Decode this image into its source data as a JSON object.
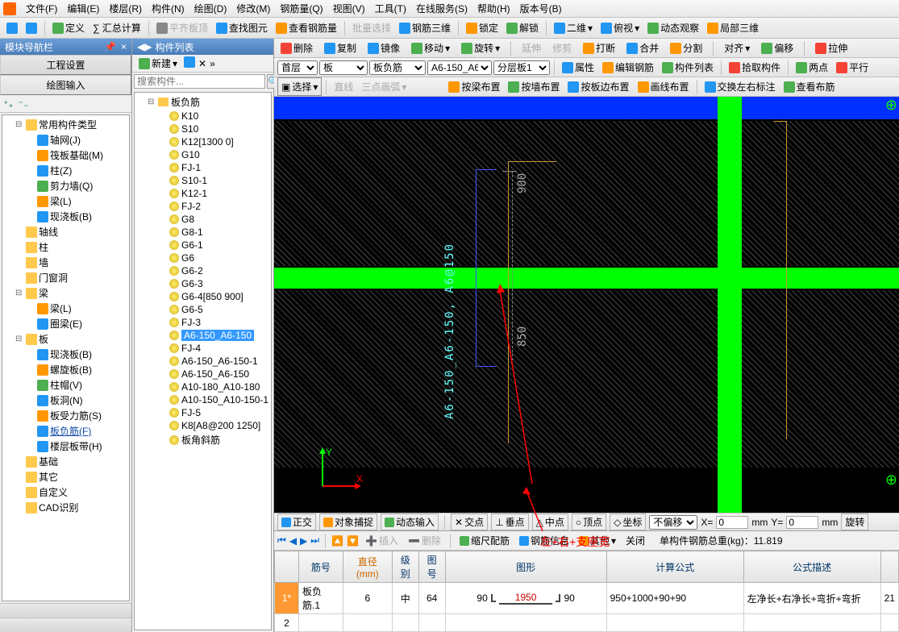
{
  "menubar": {
    "items": [
      "文件(F)",
      "编辑(E)",
      "楼层(R)",
      "构件(N)",
      "绘图(D)",
      "修改(M)",
      "钢筋量(Q)",
      "视图(V)",
      "工具(T)",
      "在线服务(S)",
      "帮助(H)",
      "版本号(B)"
    ]
  },
  "toolbar1": {
    "items": [
      "定义",
      "∑ 汇总计算",
      "平齐板顶",
      "查找图元",
      "查看钢筋量",
      "批量选择",
      "钢筋三维",
      "锁定",
      "解锁",
      "二维",
      "俯视",
      "动态观察",
      "局部三维"
    ]
  },
  "navpanel": {
    "title": "模块导航栏",
    "tabs": [
      "工程设置",
      "绘图输入"
    ],
    "tree": [
      {
        "label": "常用构件类型",
        "icon": "folder",
        "exp": true,
        "children": [
          {
            "label": "轴网(J)",
            "icon": "blue"
          },
          {
            "label": "筏板基础(M)",
            "icon": "orange"
          },
          {
            "label": "柱(Z)",
            "icon": "blue"
          },
          {
            "label": "剪力墙(Q)",
            "icon": "green"
          },
          {
            "label": "梁(L)",
            "icon": "orange"
          },
          {
            "label": "现浇板(B)",
            "icon": "blue"
          }
        ]
      },
      {
        "label": "轴线",
        "icon": "folder"
      },
      {
        "label": "柱",
        "icon": "folder"
      },
      {
        "label": "墙",
        "icon": "folder"
      },
      {
        "label": "门窗洞",
        "icon": "folder"
      },
      {
        "label": "梁",
        "icon": "folder",
        "exp": true,
        "children": [
          {
            "label": "梁(L)",
            "icon": "orange"
          },
          {
            "label": "圈梁(E)",
            "icon": "blue"
          }
        ]
      },
      {
        "label": "板",
        "icon": "folder",
        "exp": true,
        "children": [
          {
            "label": "现浇板(B)",
            "icon": "blue"
          },
          {
            "label": "螺旋板(B)",
            "icon": "orange"
          },
          {
            "label": "柱帽(V)",
            "icon": "green"
          },
          {
            "label": "板洞(N)",
            "icon": "blue"
          },
          {
            "label": "板受力筋(S)",
            "icon": "orange"
          },
          {
            "label": "板负筋(F)",
            "icon": "blue",
            "sel": true
          },
          {
            "label": "楼层板带(H)",
            "icon": "blue"
          }
        ]
      },
      {
        "label": "基础",
        "icon": "folder"
      },
      {
        "label": "其它",
        "icon": "folder"
      },
      {
        "label": "自定义",
        "icon": "folder"
      },
      {
        "label": "CAD识别",
        "icon": "folder"
      }
    ]
  },
  "complist": {
    "title": "构件列表",
    "newBtn": "新建",
    "searchPlaceholder": "搜索构件...",
    "root": "板负筋",
    "items": [
      "K10",
      "S10",
      "K12[1300 0]",
      "G10",
      "FJ-1",
      "S10-1",
      "K12-1",
      "FJ-2",
      "G8",
      "G8-1",
      "G6-1",
      "G6",
      "G6-2",
      "G6-3",
      "G6-4[850 900]",
      "G6-5",
      "FJ-3",
      "A6-150_A6-150",
      "FJ-4",
      "A6-150_A6-150-1",
      "A6-150_A6-150",
      "A10-180_A10-180",
      "A10-150_A10-150-1",
      "FJ-5",
      "K8[A8@200 1250]",
      "板角斜筋"
    ],
    "selected": "A6-150_A6-150"
  },
  "drawtb1": {
    "items": [
      "删除",
      "复制",
      "镜像",
      "移动",
      "旋转",
      "延伸",
      "修剪",
      "打断",
      "合并",
      "分割",
      "对齐",
      "偏移",
      "拉伸"
    ]
  },
  "drawtb2": {
    "floor": "首层",
    "type": "板",
    "sub": "板负筋",
    "comp": "A6-150_A6",
    "layer": "分层板1",
    "items": [
      "属性",
      "编辑钢筋",
      "构件列表",
      "拾取构件",
      "两点",
      "平行"
    ]
  },
  "drawtb3": {
    "items": [
      "选择",
      "直线",
      "三点画弧",
      "按梁布置",
      "按墙布置",
      "按板边布置",
      "画线布置",
      "交换左右标注",
      "查看布筋"
    ]
  },
  "statusbar": {
    "items": [
      "正交",
      "对象捕捉",
      "动态输入",
      "交点",
      "垂点",
      "中点",
      "顶点",
      "坐标"
    ],
    "offset": "不偏移",
    "xlabel": "X=",
    "xunit": "mm",
    "ylabel": "Y=",
    "yunit": "mm",
    "rotate": "旋转"
  },
  "bottombar": {
    "items": [
      "插入",
      "删除",
      "缩尺配筋",
      "钢筋信息",
      "其他",
      "关闭"
    ],
    "weight_label": "单构件钢筋总重(kg)：",
    "weight": "11.819"
  },
  "table": {
    "headers": [
      "",
      "筋号",
      "直径(mm)",
      "级别",
      "图号",
      "图形",
      "计算公式",
      "公式描述",
      ""
    ],
    "rows": [
      {
        "idx": "1*",
        "name": "板负筋.1",
        "dia": "6",
        "grade": "中",
        "pic": "64",
        "left": "90",
        "len": "1950",
        "right": "90",
        "formula": "950+1000+90+90",
        "desc": "左净长+右净长+弯折+弯折",
        "last": "21"
      },
      {
        "idx": "2"
      }
    ]
  },
  "canvas": {
    "label": "A6-150_A6-150, A6@150",
    "dim1": "900",
    "dim2": "850",
    "axis_x": "X",
    "axis_y": "Y"
  },
  "annotation": "左+右+支座宽"
}
